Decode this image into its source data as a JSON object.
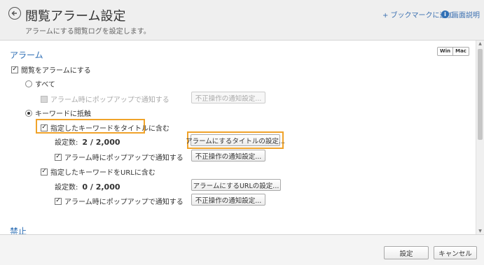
{
  "header": {
    "title": "閲覧アラーム設定",
    "subtitle": "アラームにする閲覧ログを設定します。",
    "bookmark_link": "+ ブックマークに追加",
    "help_link": "画面説明"
  },
  "alarm_section": {
    "title": "アラーム",
    "os_toggle": {
      "win": "Win",
      "mac": "Mac"
    },
    "enable_checkbox": {
      "label": "閲覧をアラームにする",
      "checked": true
    },
    "all": {
      "label": "すべて",
      "popup_label": "アラーム時にポップアップで通知する",
      "button": "不正操作の通知設定..."
    },
    "keyword": {
      "label": "キーワードに抵触",
      "title_rule": {
        "checkbox_label": "指定したキーワードをタイトルに含む",
        "count_label": "設定数:",
        "count_value": "2 / 2,000",
        "settings_button": "アラームにするタイトルの設定...",
        "popup_label": "アラーム時にポップアップで通知する",
        "notify_button": "不正操作の通知設定..."
      },
      "url_rule": {
        "checkbox_label": "指定したキーワードをURLに含む",
        "count_label": "設定数:",
        "count_value": "0 / 2,000",
        "settings_button": "アラームにするURLの設定...",
        "popup_label": "アラーム時にポップアップで通知する",
        "notify_button": "不正操作の通知設定..."
      }
    }
  },
  "prohibit_section": {
    "title": "禁止"
  },
  "footer": {
    "ok_label": "設定",
    "cancel_label": "キャンセル"
  },
  "colors": {
    "accent": "#2f6fb5",
    "highlight": "#f0a32a"
  }
}
